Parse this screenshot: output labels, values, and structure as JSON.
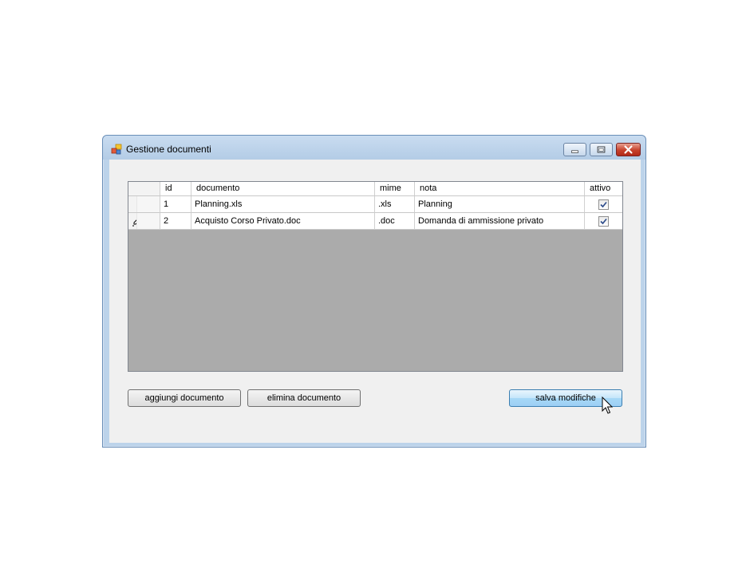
{
  "window": {
    "title": "Gestione documenti"
  },
  "grid": {
    "columns": [
      "id",
      "documento",
      "mime",
      "nota",
      "attivo"
    ],
    "rows": [
      {
        "id": "1",
        "documento": "Planning.xls",
        "mime": ".xls",
        "nota": "Planning",
        "attivo": true
      },
      {
        "id": "2",
        "documento": "Acquisto Corso Privato.doc",
        "mime": ".doc",
        "nota": "Domanda di ammissione privato",
        "attivo": true,
        "editing": true
      }
    ]
  },
  "buttons": {
    "add_label": "aggiungi documento",
    "delete_label": "elimina documento",
    "save_label": "salva modifiche"
  },
  "colors": {
    "grid_background": "#ababab",
    "save_button_accent": "#9ccff4",
    "close_button": "#c7412c"
  },
  "icons": {
    "app": "app-window-icon",
    "edit_row": "pencil-icon",
    "cursor": "mouse-pointer-icon"
  }
}
